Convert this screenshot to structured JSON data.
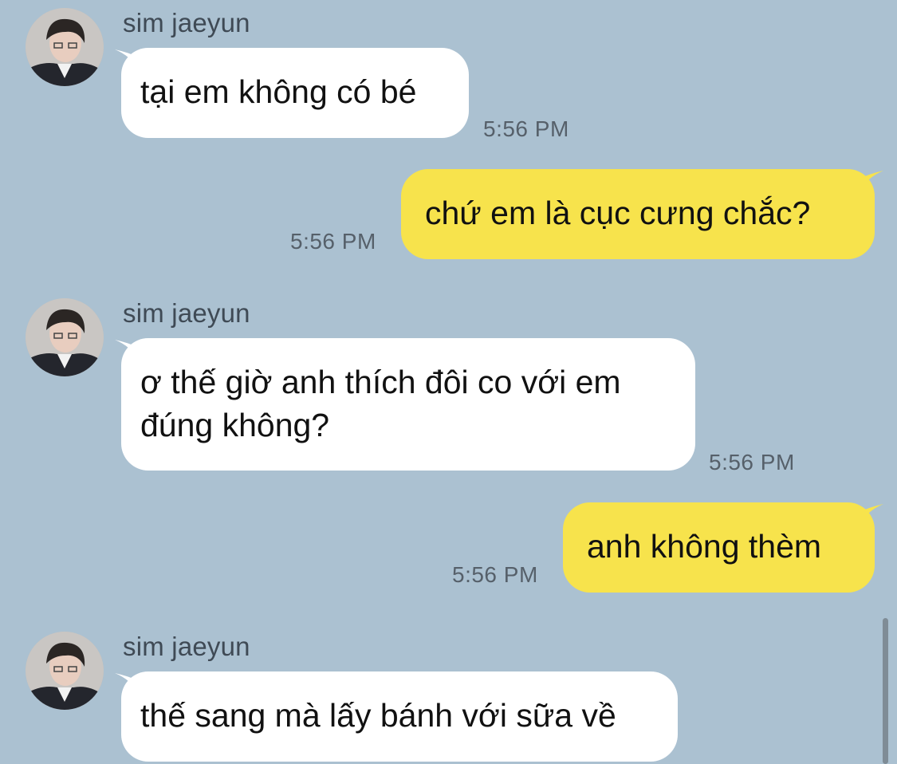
{
  "chat": {
    "messages": [
      {
        "sender": "sim jaeyun",
        "text": "tại em không có bé",
        "time": "5:56 PM",
        "direction": "incoming"
      },
      {
        "text": "chứ em là cục cưng chắc?",
        "time": "5:56 PM",
        "direction": "outgoing"
      },
      {
        "sender": "sim jaeyun",
        "text_line1": "ơ thế giờ anh thích đôi co với em",
        "text_line2": "đúng không?",
        "time": "5:56 PM",
        "direction": "incoming"
      },
      {
        "text": "anh không thèm",
        "time": "5:56 PM",
        "direction": "outgoing"
      },
      {
        "sender": "sim jaeyun",
        "text": "thế sang mà lấy bánh với sữa về",
        "direction": "incoming"
      }
    ]
  },
  "colors": {
    "background": "#abc1d1",
    "incoming_bubble": "#ffffff",
    "outgoing_bubble": "#f7e34c"
  }
}
